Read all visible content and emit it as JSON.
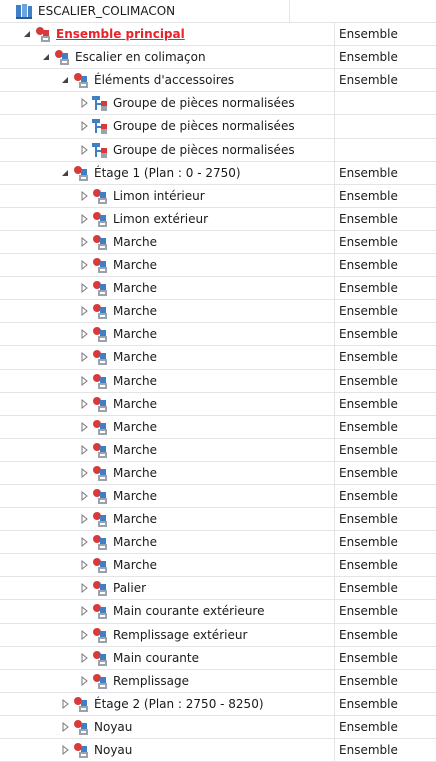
{
  "tree": {
    "root": {
      "label": "ESCALIER_COLIMACON",
      "icon": "stair-assembly-icon"
    },
    "rows": [
      {
        "label": "Ensemble principal",
        "type": "Ensemble",
        "level": 1,
        "expanded": true,
        "icon": "assembly-red-icon",
        "highlight": true
      },
      {
        "label": "Escalier en colimaçon",
        "type": "Ensemble",
        "level": 2,
        "expanded": true,
        "icon": "assembly-icon"
      },
      {
        "label": "Éléments d'accessoires",
        "type": "Ensemble",
        "level": 3,
        "expanded": true,
        "icon": "assembly-icon"
      },
      {
        "label": "Groupe de pièces normalisées",
        "type": "",
        "level": 4,
        "expanded": false,
        "icon": "standard-parts-icon"
      },
      {
        "label": "Groupe de pièces normalisées",
        "type": "",
        "level": 4,
        "expanded": false,
        "icon": "standard-parts-icon"
      },
      {
        "label": "Groupe de pièces normalisées",
        "type": "",
        "level": 4,
        "expanded": false,
        "icon": "standard-parts-icon"
      },
      {
        "label": "Étage 1 (Plan : 0 - 2750)",
        "type": "Ensemble",
        "level": 3,
        "expanded": true,
        "icon": "assembly-icon"
      },
      {
        "label": "Limon intérieur",
        "type": "Ensemble",
        "level": 4,
        "expanded": false,
        "icon": "assembly-icon"
      },
      {
        "label": "Limon extérieur",
        "type": "Ensemble",
        "level": 4,
        "expanded": false,
        "icon": "assembly-icon"
      },
      {
        "label": "Marche",
        "type": "Ensemble",
        "level": 4,
        "expanded": false,
        "icon": "assembly-icon"
      },
      {
        "label": "Marche",
        "type": "Ensemble",
        "level": 4,
        "expanded": false,
        "icon": "assembly-icon"
      },
      {
        "label": "Marche",
        "type": "Ensemble",
        "level": 4,
        "expanded": false,
        "icon": "assembly-icon"
      },
      {
        "label": "Marche",
        "type": "Ensemble",
        "level": 4,
        "expanded": false,
        "icon": "assembly-icon"
      },
      {
        "label": "Marche",
        "type": "Ensemble",
        "level": 4,
        "expanded": false,
        "icon": "assembly-icon"
      },
      {
        "label": "Marche",
        "type": "Ensemble",
        "level": 4,
        "expanded": false,
        "icon": "assembly-icon"
      },
      {
        "label": "Marche",
        "type": "Ensemble",
        "level": 4,
        "expanded": false,
        "icon": "assembly-icon"
      },
      {
        "label": "Marche",
        "type": "Ensemble",
        "level": 4,
        "expanded": false,
        "icon": "assembly-icon"
      },
      {
        "label": "Marche",
        "type": "Ensemble",
        "level": 4,
        "expanded": false,
        "icon": "assembly-icon"
      },
      {
        "label": "Marche",
        "type": "Ensemble",
        "level": 4,
        "expanded": false,
        "icon": "assembly-icon"
      },
      {
        "label": "Marche",
        "type": "Ensemble",
        "level": 4,
        "expanded": false,
        "icon": "assembly-icon"
      },
      {
        "label": "Marche",
        "type": "Ensemble",
        "level": 4,
        "expanded": false,
        "icon": "assembly-icon"
      },
      {
        "label": "Marche",
        "type": "Ensemble",
        "level": 4,
        "expanded": false,
        "icon": "assembly-icon"
      },
      {
        "label": "Marche",
        "type": "Ensemble",
        "level": 4,
        "expanded": false,
        "icon": "assembly-icon"
      },
      {
        "label": "Marche",
        "type": "Ensemble",
        "level": 4,
        "expanded": false,
        "icon": "assembly-icon"
      },
      {
        "label": "Palier",
        "type": "Ensemble",
        "level": 4,
        "expanded": false,
        "icon": "assembly-icon"
      },
      {
        "label": "Main courante extérieure",
        "type": "Ensemble",
        "level": 4,
        "expanded": false,
        "icon": "assembly-icon"
      },
      {
        "label": "Remplissage extérieur",
        "type": "Ensemble",
        "level": 4,
        "expanded": false,
        "icon": "assembly-icon"
      },
      {
        "label": "Main courante",
        "type": "Ensemble",
        "level": 4,
        "expanded": false,
        "icon": "assembly-icon"
      },
      {
        "label": "Remplissage",
        "type": "Ensemble",
        "level": 4,
        "expanded": false,
        "icon": "assembly-icon"
      },
      {
        "label": "Étage 2 (Plan : 2750 - 8250)",
        "type": "Ensemble",
        "level": 3,
        "expanded": false,
        "icon": "assembly-icon"
      },
      {
        "label": "Noyau",
        "type": "Ensemble",
        "level": 3,
        "expanded": false,
        "icon": "assembly-icon"
      },
      {
        "label": "Noyau",
        "type": "Ensemble",
        "level": 3,
        "expanded": false,
        "icon": "assembly-icon"
      }
    ]
  },
  "colors": {
    "highlight_text": "#e8232a",
    "grid_line": "#e4e4e4",
    "icon_blue": "#3f7fc4",
    "icon_red": "#d83a3a",
    "icon_gray": "#9aa3ad"
  }
}
